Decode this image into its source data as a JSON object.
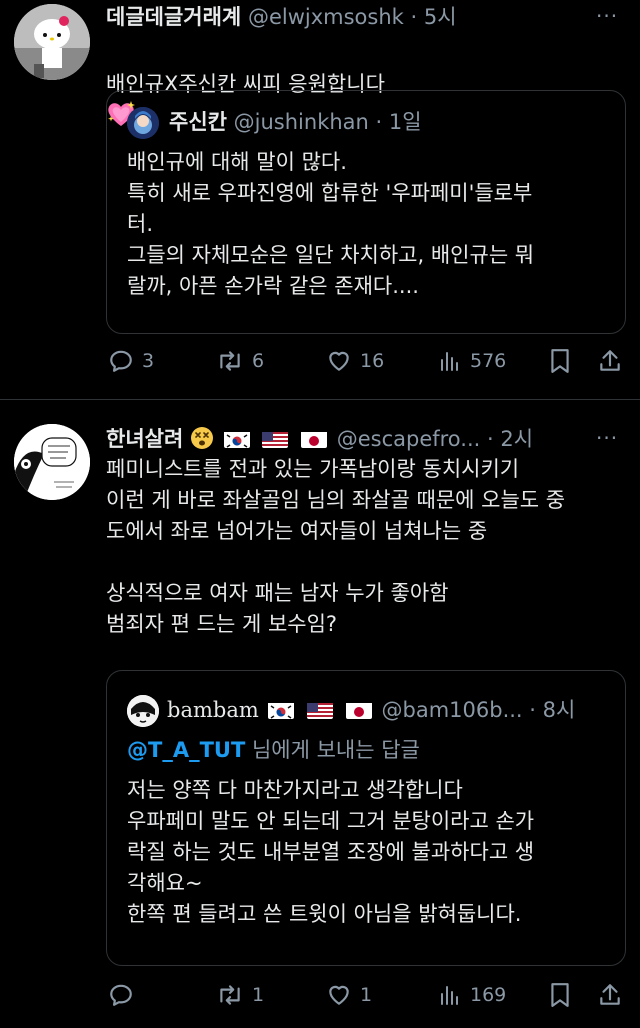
{
  "tweet1": {
    "display_name": "데글데글거래계",
    "handle": "@elwjxmsoshk",
    "time": "5시",
    "text": "배인규X주신칸 씨피 응원합니다",
    "emoji_name": "sparkling-heart",
    "quote": {
      "display_name": "주신칸",
      "handle": "@jushinkhan",
      "time": "1일",
      "text": "배인규에 대해 말이 많다.\n특히 새로 우파진영에 합류한 '우파페미'들로부\n터.\n그들의 자체모순은 일단 차치하고, 배인규는 뭐\n랄까, 아픈 손가락 같은 존재다...."
    },
    "actions": {
      "replies": "3",
      "reposts": "6",
      "likes": "16",
      "views": "576"
    }
  },
  "tweet2": {
    "display_name": "한녀살려",
    "handle": "@escapefro...",
    "time": "2시",
    "text": "페미니스트를 전과 있는 가폭남이랑 동치시키기\n이런 게 바로 좌살골임 님의 좌살골 때문에 오늘도 중\n도에서 좌로 넘어가는 여자들이 넘쳐나는 중\n\n상식적으로 여자 패는 남자 누가 좋아함\n범죄자 편 드는 게 보수임?",
    "quote": {
      "display_name": "bambam",
      "handle": "@bam106b...",
      "time": "8시",
      "reply_mention": "@T_A_TUT",
      "reply_suffix": "님에게 보내는 답글",
      "text": "저는 양쪽 다 마찬가지라고 생각합니다\n우파페미 말도 안 되는데 그거 분탕이라고 손가\n락질 하는 것도 내부분열 조장에 불과하다고 생\n각해요~\n한쪽 편 들려고 쓴 트윗이 아님을 밝혀둡니다."
    },
    "actions": {
      "replies": "",
      "reposts": "1",
      "likes": "1",
      "views": "169"
    }
  },
  "colors": {
    "background": "#000000",
    "text": "#e7e9ea",
    "muted": "#8b98a5",
    "link": "#1d9bf0",
    "border": "#2f3336"
  }
}
